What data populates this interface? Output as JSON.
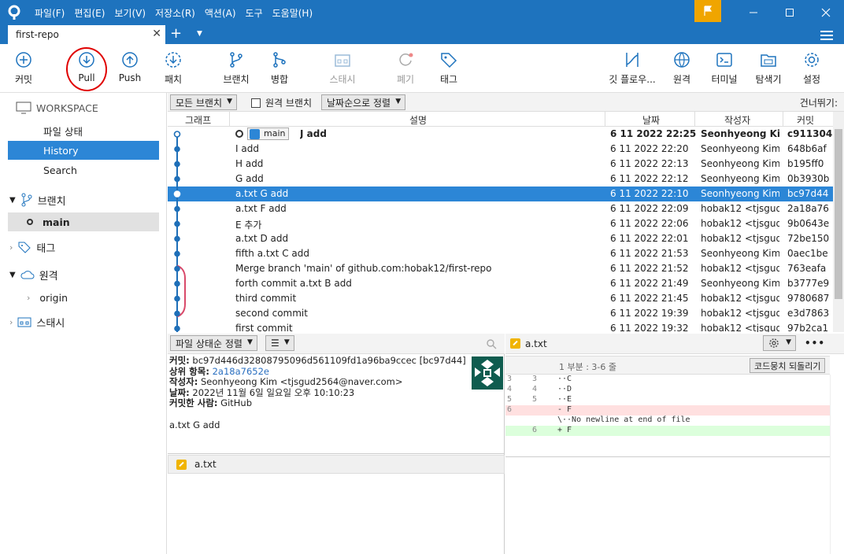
{
  "menu": [
    "파일(F)",
    "편집(E)",
    "보기(V)",
    "저장소(R)",
    "액션(A)",
    "도구",
    "도움말(H)"
  ],
  "tab": {
    "title": "first-repo",
    "close": "✕",
    "add": "+"
  },
  "toolbar": {
    "commit": "커밋",
    "pull": "Pull",
    "push": "Push",
    "fetch": "패치",
    "branch": "브랜치",
    "merge": "병합",
    "stash": "스태시",
    "discard": "폐기",
    "tag": "태그",
    "gitflow": "깃 플로우...",
    "remote": "원격",
    "terminal": "터미널",
    "explorer": "탐색기",
    "settings": "설정"
  },
  "sidebar": {
    "workspace": "WORKSPACE",
    "file_status": "파일 상태",
    "history": "History",
    "search": "Search",
    "branches": "브랜치",
    "branch_main": "main",
    "tags": "태그",
    "remotes": "원격",
    "remote_origin": "origin",
    "stashes": "스태시"
  },
  "filter": {
    "all_branches": "모든 브랜치",
    "remote_branches": "원격 브랜치",
    "sort": "날짜순으로 정렬",
    "skip": "건너뛰기:"
  },
  "columns": {
    "graph": "그래프",
    "desc": "설명",
    "date": "날짜",
    "author": "작성자",
    "commit": "커밋"
  },
  "branch_label": "main",
  "commits": [
    {
      "desc": "J add",
      "date": "6 11 2022 22:25",
      "author": "Seonhyeong Kim",
      "hash": "c911304"
    },
    {
      "desc": "I add",
      "date": "6 11 2022 22:20",
      "author": "Seonhyeong Kim",
      "hash": "648b6af"
    },
    {
      "desc": "H add",
      "date": "6 11 2022 22:13",
      "author": "Seonhyeong Kim",
      "hash": "b195ff0"
    },
    {
      "desc": "G add",
      "date": "6 11 2022 22:12",
      "author": "Seonhyeong Kim",
      "hash": "0b3930b"
    },
    {
      "desc": "a.txt G add",
      "date": "6 11 2022 22:10",
      "author": "Seonhyeong Kim",
      "hash": "bc97d44"
    },
    {
      "desc": "a.txt F add",
      "date": "6 11 2022 22:09",
      "author": "hobak12 <tjsgud2",
      "hash": "2a18a76"
    },
    {
      "desc": "E 추가",
      "date": "6 11 2022 22:06",
      "author": "hobak12 <tjsgud2",
      "hash": "9b0643e"
    },
    {
      "desc": "a.txt D add",
      "date": "6 11 2022 22:01",
      "author": "hobak12 <tjsgud2",
      "hash": "72be150"
    },
    {
      "desc": "fifth a.txt C add",
      "date": "6 11 2022 21:53",
      "author": "Seonhyeong Kim",
      "hash": "0aec1be"
    },
    {
      "desc": "Merge branch 'main' of github.com:hobak12/first-repo",
      "date": "6 11 2022 21:52",
      "author": "hobak12 <tjsgud2",
      "hash": "763eafa"
    },
    {
      "desc": "forth commit a.txt B add",
      "date": "6 11 2022 21:49",
      "author": "Seonhyeong Kim",
      "hash": "b3777e9"
    },
    {
      "desc": "third commit",
      "date": "6 11 2022 21:45",
      "author": "hobak12 <tjsgud2",
      "hash": "9780687"
    },
    {
      "desc": "second commit",
      "date": "6 11 2022 19:39",
      "author": "hobak12 <tjsgud2",
      "hash": "e3d7863"
    },
    {
      "desc": "first commit",
      "date": "6 11 2022 19:32",
      "author": "hobak12 <tjsgud2",
      "hash": "97b2ca1"
    }
  ],
  "lower_left": {
    "sort": "파일 상태순 정렬",
    "view": "☰",
    "commit_label": "커밋:",
    "commit_value": "bc97d446d32808795096d561109fd1a96ba9ccec [bc97d44]",
    "parent_label": "상위 항목:",
    "parent_value": "2a18a7652e",
    "author_label": "작성자:",
    "author_value": "Seonhyeong Kim <tjsgud2564@naver.com>",
    "date_label": "날짜:",
    "date_value": "2022년 11월 6일 일요일 오후 10:10:23",
    "committer_label": "커밋한 사람:",
    "committer_value": "GitHub",
    "message": "a.txt G add",
    "file": "a.txt"
  },
  "lower_right": {
    "file": "a.txt",
    "hunk": "1 부분 : 3-6 줄",
    "revert": "코드뭉치 되돌리기",
    "more": "•••",
    "diff": [
      {
        "old": "3",
        "new": "3",
        "text": "··C",
        "kind": "ctx"
      },
      {
        "old": "4",
        "new": "4",
        "text": "··D",
        "kind": "ctx"
      },
      {
        "old": "5",
        "new": "5",
        "text": "··E",
        "kind": "ctx"
      },
      {
        "old": "6",
        "new": "",
        "text": "- F",
        "kind": "del"
      },
      {
        "old": "",
        "new": "",
        "text": "\\··No newline at end of file",
        "kind": "ctx"
      },
      {
        "old": "",
        "new": "6",
        "text": "+ F",
        "kind": "add"
      }
    ]
  },
  "colors": {
    "accent": "#1e73be",
    "selection": "#2c86d6",
    "graph_line": "#1e6fb8",
    "graph_merge": "#d94a6a",
    "flag": "#f0a500"
  }
}
